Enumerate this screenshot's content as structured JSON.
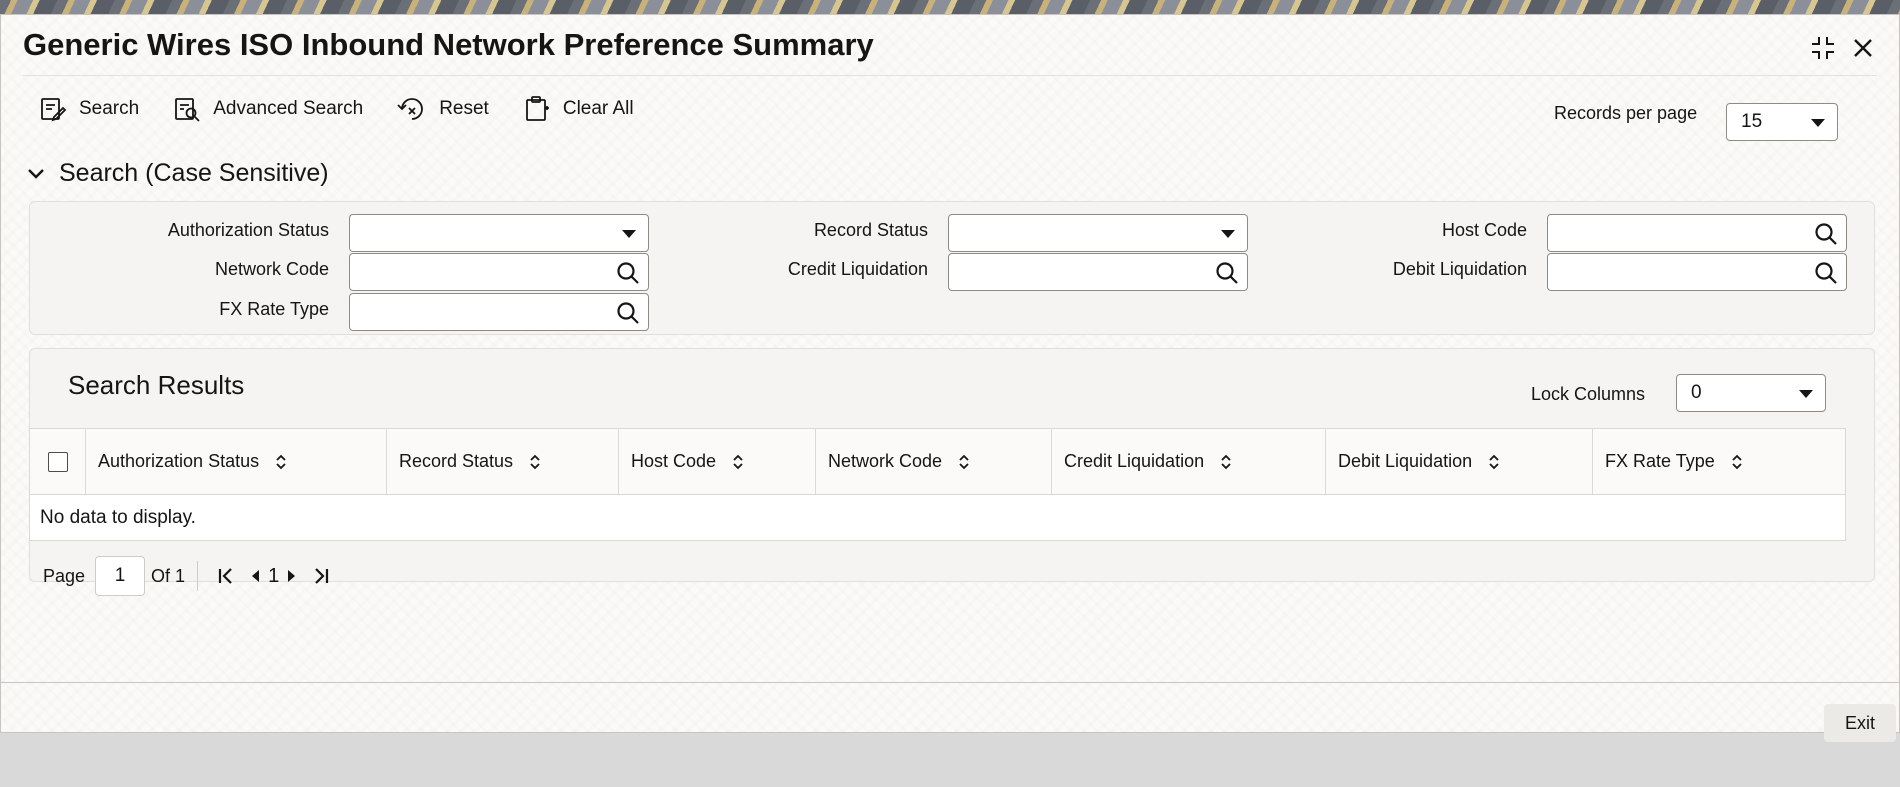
{
  "window": {
    "title": "Generic Wires ISO Inbound Network Preference Summary"
  },
  "toolbar": {
    "search_label": "Search",
    "advanced_search_label": "Advanced Search",
    "reset_label": "Reset",
    "clear_all_label": "Clear All"
  },
  "records_per_page": {
    "label": "Records per page",
    "value": "15"
  },
  "search_section": {
    "title": "Search (Case Sensitive)",
    "fields": {
      "authorization_status": {
        "label": "Authorization Status",
        "value": ""
      },
      "record_status": {
        "label": "Record Status",
        "value": ""
      },
      "host_code": {
        "label": "Host Code",
        "value": ""
      },
      "network_code": {
        "label": "Network Code",
        "value": ""
      },
      "credit_liquidation": {
        "label": "Credit Liquidation",
        "value": ""
      },
      "debit_liquidation": {
        "label": "Debit Liquidation",
        "value": ""
      },
      "fx_rate_type": {
        "label": "FX Rate Type",
        "value": ""
      }
    }
  },
  "results": {
    "title": "Search Results",
    "lock_columns": {
      "label": "Lock Columns",
      "value": "0"
    },
    "columns": [
      "Authorization Status",
      "Record Status",
      "Host Code",
      "Network Code",
      "Credit Liquidation",
      "Debit Liquidation",
      "FX Rate Type"
    ],
    "empty_message": "No data to display.",
    "pager": {
      "page_label": "Page",
      "current_page": "1",
      "of_label": "Of 1",
      "page_number": "1"
    }
  },
  "footer": {
    "exit_label": "Exit"
  },
  "colors": {
    "text": "#161513",
    "border": "#8e8b86",
    "panel": "#f5f4f2"
  },
  "icons": [
    "maximize-icon",
    "close-icon",
    "search-icon",
    "advanced-search-icon",
    "reset-icon",
    "clear-all-icon",
    "chevron-down-icon",
    "magnifier-icon",
    "sort-icon",
    "first-page-icon",
    "previous-page-icon",
    "next-page-icon",
    "last-page-icon"
  ]
}
